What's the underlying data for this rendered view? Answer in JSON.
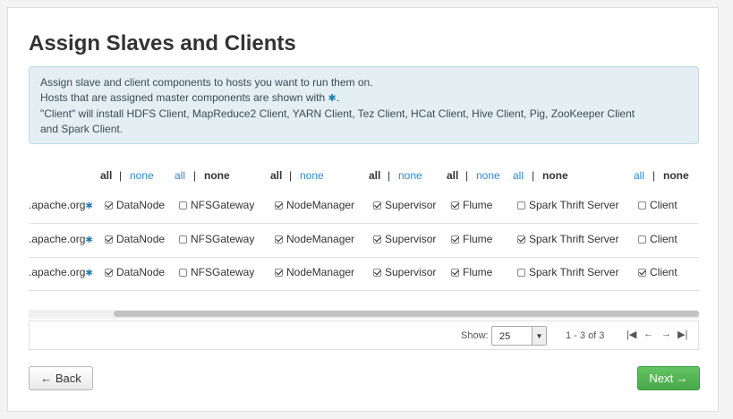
{
  "page_title": "Assign Slaves and Clients",
  "info": {
    "line1": "Assign slave and client components to hosts you want to run them on.",
    "line2_prefix": "Hosts that are assigned master components are shown with",
    "line2_star": "✱",
    "line2_suffix": ".",
    "line3": "\"Client\" will install HDFS Client, MapReduce2 Client, YARN Client, Tez Client, HCat Client, Hive Client, Pig, ZooKeeper Client",
    "line4": "and Spark Client."
  },
  "select_all_label": "all",
  "select_none_label": "none",
  "separator": "|",
  "columns": [
    "DataNode",
    "NFSGateway",
    "NodeManager",
    "Supervisor",
    "Flume",
    "Spark Thrift Server",
    "Client"
  ],
  "hosts": [
    {
      "name": ".apache.org",
      "master": "✱",
      "checks": [
        true,
        false,
        true,
        true,
        true,
        false,
        false
      ]
    },
    {
      "name": ".apache.org",
      "master": "✱",
      "checks": [
        true,
        false,
        true,
        true,
        true,
        true,
        false
      ]
    },
    {
      "name": ".apache.org",
      "master": "✱",
      "checks": [
        true,
        false,
        true,
        true,
        true,
        false,
        true
      ]
    }
  ],
  "pagination": {
    "show_label": "Show:",
    "page_size": "25",
    "range": "1 - 3 of 3"
  },
  "buttons": {
    "back": "← Back",
    "next": "Next →"
  }
}
